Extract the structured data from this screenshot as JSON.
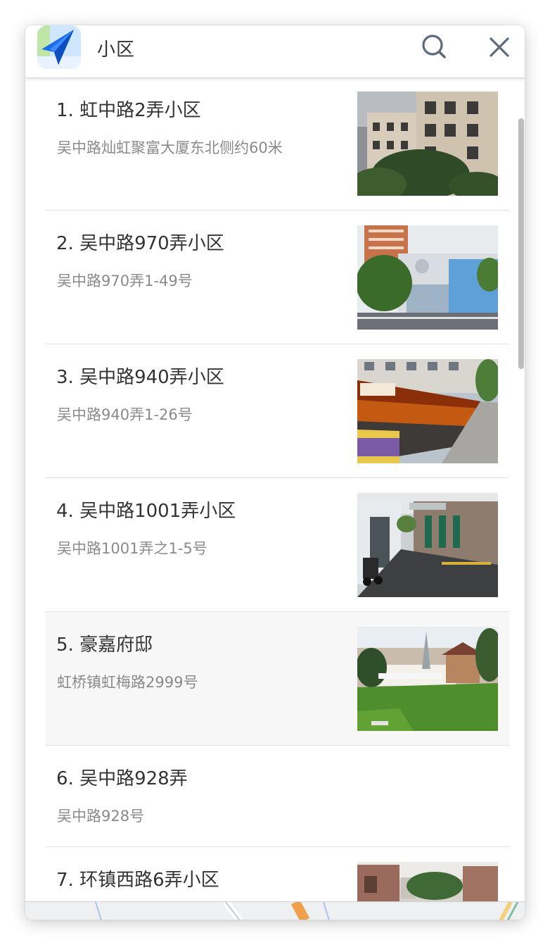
{
  "search": {
    "query": "小区",
    "search_icon": "search-icon",
    "close_icon": "close-icon",
    "logo_icon": "paper-plane-map-logo"
  },
  "results": [
    {
      "title": "1. 虹中路2弄小区",
      "address": "吴中路灿虹聚富大厦东北侧约60米",
      "has_photo": true
    },
    {
      "title": "2. 吴中路970弄小区",
      "address": "吴中路970弄1-49号",
      "has_photo": true
    },
    {
      "title": "3. 吴中路940弄小区",
      "address": "吴中路940弄1-26号",
      "has_photo": true
    },
    {
      "title": "4. 吴中路1001弄小区",
      "address": "吴中路1001弄之1-5号",
      "has_photo": true
    },
    {
      "title": "5. 豪嘉府邸",
      "address": "虹桥镇虹梅路2999号",
      "has_photo": true
    },
    {
      "title": "6. 吴中路928弄",
      "address": "吴中路928号",
      "has_photo": false
    },
    {
      "title": "7. 环镇西路6弄小区",
      "address": "",
      "has_photo": true
    }
  ],
  "colors": {
    "accent_blue": "#1a6fe8",
    "title_text": "#333333",
    "address_text": "#8a8a8a",
    "divider": "#e3e3e3",
    "hover_row": "#f7f7f7"
  }
}
